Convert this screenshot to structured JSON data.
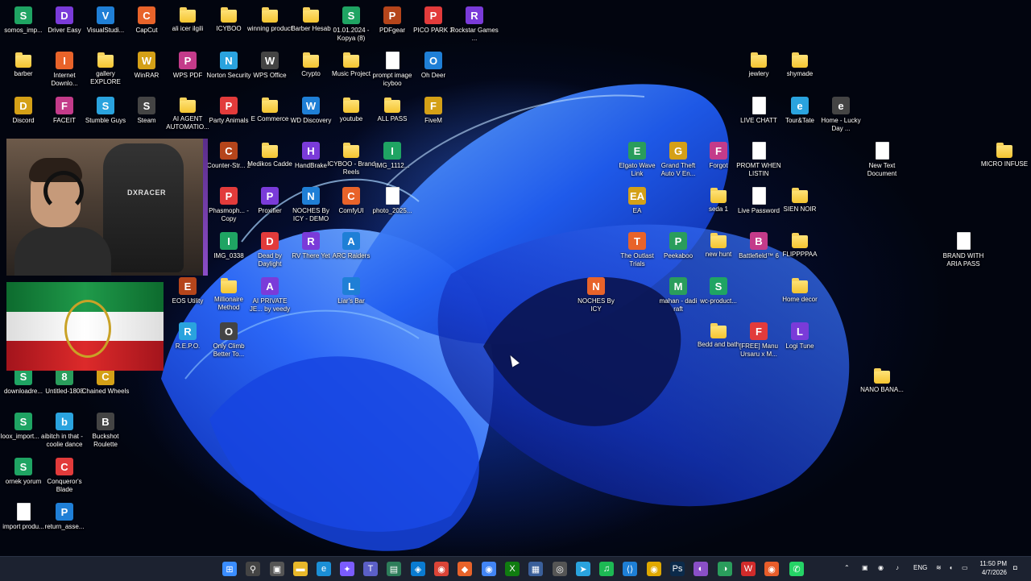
{
  "desktop": {
    "icons": [
      {
        "label": "somos_imp...",
        "kind": "sheet",
        "glyph": "S"
      },
      {
        "label": "Driver Easy",
        "kind": "app",
        "glyph": "D"
      },
      {
        "label": "VisualStudi...",
        "kind": "app",
        "glyph": "V"
      },
      {
        "label": "CapCut",
        "kind": "app",
        "glyph": "C"
      },
      {
        "label": "ali icer ilgili",
        "kind": "folder",
        "glyph": ""
      },
      {
        "label": "ICYBOO",
        "kind": "folder",
        "glyph": ""
      },
      {
        "label": "winning product",
        "kind": "folder",
        "glyph": ""
      },
      {
        "label": "Barber Hesab",
        "kind": "folder",
        "glyph": ""
      },
      {
        "label": "01.01.2024 - Kopya (8)",
        "kind": "sheet",
        "glyph": "S"
      },
      {
        "label": "PDFgear",
        "kind": "app",
        "glyph": "P"
      },
      {
        "label": "PICO PARK 2",
        "kind": "app",
        "glyph": "P"
      },
      {
        "label": "Rockstar Games ...",
        "kind": "app",
        "glyph": "R"
      },
      {
        "label": "barber",
        "kind": "folder",
        "glyph": ""
      },
      {
        "label": "Internet Downlo...",
        "kind": "app",
        "glyph": "I"
      },
      {
        "label": "gallery EXPLORE",
        "kind": "folder",
        "glyph": ""
      },
      {
        "label": "WinRAR",
        "kind": "app",
        "glyph": "W"
      },
      {
        "label": "WPS PDF",
        "kind": "app",
        "glyph": "P"
      },
      {
        "label": "Norton Security",
        "kind": "app",
        "glyph": "N"
      },
      {
        "label": "WPS Office",
        "kind": "app",
        "glyph": "W"
      },
      {
        "label": "Crypto",
        "kind": "folder",
        "glyph": ""
      },
      {
        "label": "Music Project",
        "kind": "folder",
        "glyph": ""
      },
      {
        "label": "prompt image icyboo",
        "kind": "doc",
        "glyph": ""
      },
      {
        "label": "Oh Deer",
        "kind": "app",
        "glyph": "O"
      },
      {
        "label": "jewlery",
        "kind": "folder",
        "glyph": ""
      },
      {
        "label": "shymade",
        "kind": "folder",
        "glyph": ""
      },
      {
        "label": "Discord",
        "kind": "app",
        "glyph": "D"
      },
      {
        "label": "FACEIT",
        "kind": "app",
        "glyph": "F"
      },
      {
        "label": "Stumble Guys",
        "kind": "app",
        "glyph": "S"
      },
      {
        "label": "Steam",
        "kind": "app",
        "glyph": "S"
      },
      {
        "label": "AI AGENT AUTOMATIO...",
        "kind": "folder",
        "glyph": ""
      },
      {
        "label": "Party Animals",
        "kind": "app",
        "glyph": "P"
      },
      {
        "label": "E Commerce",
        "kind": "folder",
        "glyph": ""
      },
      {
        "label": "WD Discovery",
        "kind": "app",
        "glyph": "W"
      },
      {
        "label": "youtube",
        "kind": "folder",
        "glyph": ""
      },
      {
        "label": "ALL PASS",
        "kind": "folder",
        "glyph": ""
      },
      {
        "label": "FiveM",
        "kind": "app",
        "glyph": "F"
      },
      {
        "label": "LIVE CHATT",
        "kind": "doc",
        "glyph": ""
      },
      {
        "label": "Tour&Tate",
        "kind": "app",
        "glyph": "e"
      },
      {
        "label": "Home - Lucky Day ...",
        "kind": "app",
        "glyph": "e"
      },
      {
        "label": "Counter-Str... 2",
        "kind": "app",
        "glyph": "C"
      },
      {
        "label": "Medikos Cadde",
        "kind": "folder",
        "glyph": ""
      },
      {
        "label": "HandBrake",
        "kind": "app",
        "glyph": "H"
      },
      {
        "label": "ICYBOO - Brand Reels",
        "kind": "folder",
        "glyph": ""
      },
      {
        "label": "IMG_1112...",
        "kind": "sheet",
        "glyph": "I"
      },
      {
        "label": "Elgato Wave Link",
        "kind": "app",
        "glyph": "E"
      },
      {
        "label": "Grand Theft Auto V En...",
        "kind": "app",
        "glyph": "G"
      },
      {
        "label": "Forgot",
        "kind": "app",
        "glyph": "F"
      },
      {
        "label": "PROMT WHEN LISTIN",
        "kind": "doc",
        "glyph": ""
      },
      {
        "label": "New Text Document",
        "kind": "doc",
        "glyph": ""
      },
      {
        "label": "MICRO INFUSE",
        "kind": "folder",
        "glyph": ""
      },
      {
        "label": "Phasmoph... - Copy",
        "kind": "app",
        "glyph": "P"
      },
      {
        "label": "Proxifier",
        "kind": "app",
        "glyph": "P"
      },
      {
        "label": "NOCHES By ICY - DEMO",
        "kind": "app",
        "glyph": "N"
      },
      {
        "label": "ComfyUI",
        "kind": "app",
        "glyph": "C"
      },
      {
        "label": "photo_2025...",
        "kind": "doc",
        "glyph": ""
      },
      {
        "label": "EA",
        "kind": "app",
        "glyph": "EA"
      },
      {
        "label": "seda 1",
        "kind": "folder",
        "glyph": ""
      },
      {
        "label": "Live Password",
        "kind": "doc",
        "glyph": ""
      },
      {
        "label": "SIEN NOIR",
        "kind": "folder",
        "glyph": ""
      },
      {
        "label": "IMG_0338",
        "kind": "sheet",
        "glyph": "I"
      },
      {
        "label": "Dead by Daylight",
        "kind": "app",
        "glyph": "D"
      },
      {
        "label": "RV There Yet",
        "kind": "app",
        "glyph": "R"
      },
      {
        "label": "ARC Raiders",
        "kind": "app",
        "glyph": "A"
      },
      {
        "label": "The Outlast Trials",
        "kind": "app",
        "glyph": "T"
      },
      {
        "label": "Peekaboo",
        "kind": "app",
        "glyph": "P"
      },
      {
        "label": "new hunt",
        "kind": "folder",
        "glyph": ""
      },
      {
        "label": "Battlefield™ 6",
        "kind": "app",
        "glyph": "B"
      },
      {
        "label": "FLIPPPPAA",
        "kind": "folder",
        "glyph": ""
      },
      {
        "label": "BRAND WITH ARIA PASS",
        "kind": "doc",
        "glyph": ""
      },
      {
        "label": "EOS Utility",
        "kind": "app",
        "glyph": "E"
      },
      {
        "label": "Millionaire Method",
        "kind": "folder",
        "glyph": ""
      },
      {
        "label": "AI PRIVATE JE... by veedy o...",
        "kind": "app",
        "glyph": "A"
      },
      {
        "label": "Liar's Bar",
        "kind": "app",
        "glyph": "L"
      },
      {
        "label": "NOCHES By ICY",
        "kind": "app",
        "glyph": "N"
      },
      {
        "label": "mahan - dadi raft",
        "kind": "app",
        "glyph": "M"
      },
      {
        "label": "wc-product...",
        "kind": "sheet",
        "glyph": "S"
      },
      {
        "label": "Home decor",
        "kind": "folder",
        "glyph": ""
      },
      {
        "label": "R.E.P.O.",
        "kind": "app",
        "glyph": "R"
      },
      {
        "label": "Only Climb Better To...",
        "kind": "app",
        "glyph": "O"
      },
      {
        "label": "Bedd and bath",
        "kind": "folder",
        "glyph": ""
      },
      {
        "label": "[FREE] Manu Ursaru x M...",
        "kind": "app",
        "glyph": "F"
      },
      {
        "label": "Logi Tune",
        "kind": "app",
        "glyph": "L"
      },
      {
        "label": "NANO BANA...",
        "kind": "folder",
        "glyph": ""
      },
      {
        "label": "downloadre...",
        "kind": "sheet",
        "glyph": "S"
      },
      {
        "label": "Untitled-1808",
        "kind": "app",
        "glyph": "8"
      },
      {
        "label": "Chained Wheels",
        "kind": "app",
        "glyph": "C"
      },
      {
        "label": "loox_import... ai",
        "kind": "sheet",
        "glyph": "S"
      },
      {
        "label": "bitch in that - coolie dance",
        "kind": "app",
        "glyph": "b"
      },
      {
        "label": "Buckshot Roulette",
        "kind": "app",
        "glyph": "B"
      },
      {
        "label": "ornek yorum",
        "kind": "sheet",
        "glyph": "S"
      },
      {
        "label": "Conqueror's Blade",
        "kind": "app",
        "glyph": "C"
      },
      {
        "label": "import produ...",
        "kind": "doc",
        "glyph": ""
      },
      {
        "label": "return_asse...",
        "kind": "app",
        "glyph": "P"
      }
    ]
  },
  "webcam": {
    "chair_brand": "DXRACER"
  },
  "taskbar": {
    "apps": [
      {
        "name": "start-icon",
        "glyph": "⊞",
        "color": "#3a8dff"
      },
      {
        "name": "search-icon",
        "glyph": "⚲",
        "color": "#444"
      },
      {
        "name": "task-view-icon",
        "glyph": "▣",
        "color": "#555"
      },
      {
        "name": "file-explorer-icon",
        "glyph": "▬",
        "color": "#e8b82a"
      },
      {
        "name": "edge-icon",
        "glyph": "e",
        "color": "#1b8fd6"
      },
      {
        "name": "copilot-icon",
        "glyph": "✦",
        "color": "#7b5cff"
      },
      {
        "name": "teams-icon",
        "glyph": "T",
        "color": "#5b5fc7"
      },
      {
        "name": "app-icon-1",
        "glyph": "▤",
        "color": "#2d7d5a"
      },
      {
        "name": "app-icon-2",
        "glyph": "◈",
        "color": "#0a7bd1"
      },
      {
        "name": "chrome-icon",
        "glyph": "◉",
        "color": "#db4437"
      },
      {
        "name": "app-icon-3",
        "glyph": "◆",
        "color": "#e8632a"
      },
      {
        "name": "chrome-icon-2",
        "glyph": "◉",
        "color": "#4285f4"
      },
      {
        "name": "xbox-icon",
        "glyph": "X",
        "color": "#107c10"
      },
      {
        "name": "app-icon-4",
        "glyph": "▦",
        "color": "#3a5f9a"
      },
      {
        "name": "chatgpt-icon",
        "glyph": "◎",
        "color": "#555"
      },
      {
        "name": "telegram-icon",
        "glyph": "➤",
        "color": "#2aa3de"
      },
      {
        "name": "spotify-icon",
        "glyph": "♫",
        "color": "#1db954"
      },
      {
        "name": "vscode-icon",
        "glyph": "⟨⟩",
        "color": "#1e7fd6"
      },
      {
        "name": "chrome-icon-3",
        "glyph": "◉",
        "color": "#e0a800"
      },
      {
        "name": "photoshop-icon",
        "glyph": "Ps",
        "color": "#0b2a4a"
      },
      {
        "name": "app-icon-5",
        "glyph": "◐",
        "color": "#8a4fc7"
      },
      {
        "name": "app-icon-6",
        "glyph": "◑",
        "color": "#2a9d5c"
      },
      {
        "name": "wps-icon",
        "glyph": "W",
        "color": "#d22b2b"
      },
      {
        "name": "chrome-icon-4",
        "glyph": "◉",
        "color": "#e85d2a"
      },
      {
        "name": "whatsapp-icon",
        "glyph": "✆",
        "color": "#25d366"
      }
    ],
    "tray": {
      "language": "ENG",
      "time": "11:50 PM",
      "date": "4/7/2026"
    }
  }
}
